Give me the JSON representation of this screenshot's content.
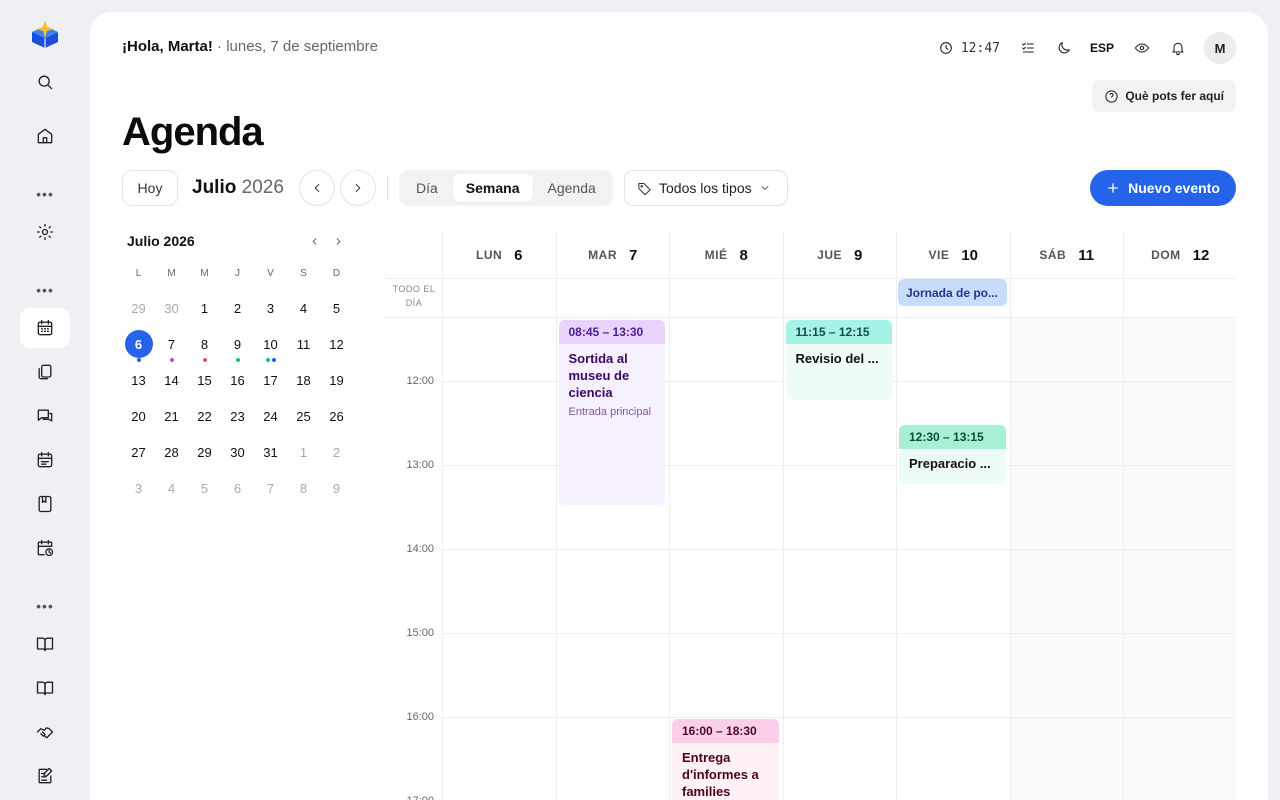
{
  "sidebar": {
    "items": [
      {
        "name": "search-icon"
      },
      {
        "name": "home-icon"
      },
      {
        "name": "settings-icon"
      },
      {
        "name": "calendar-icon"
      },
      {
        "name": "documents-icon"
      },
      {
        "name": "messages-icon"
      },
      {
        "name": "schedule-icon"
      },
      {
        "name": "notebook-icon"
      },
      {
        "name": "calendar-clock-icon"
      },
      {
        "name": "book-open-icon"
      },
      {
        "name": "book-icon"
      },
      {
        "name": "handshake-icon"
      },
      {
        "name": "edit-notes-icon"
      }
    ],
    "dots": "•••"
  },
  "header": {
    "greeting": "¡Hola, Marta!",
    "separator": " · ",
    "date": "lunes, 7 de septiembre",
    "clock": "12:47",
    "language": "ESP",
    "avatar_initial": "M",
    "help_label": "Què pots fer aquí"
  },
  "page": {
    "title": "Agenda"
  },
  "toolbar": {
    "today_label": "Hoy",
    "month": "Julio",
    "year": "2026",
    "views": [
      "Día",
      "Semana",
      "Agenda"
    ],
    "active_view": "Semana",
    "filter_label": "Todos los tipos",
    "new_event_label": "Nuevo evento"
  },
  "mini_calendar": {
    "title": "Julio 2026",
    "dow": [
      "L",
      "M",
      "M",
      "J",
      "V",
      "S",
      "D"
    ],
    "weeks": [
      [
        "29",
        "30",
        "1",
        "2",
        "3",
        "4",
        "5"
      ],
      [
        "6",
        "7",
        "8",
        "9",
        "10",
        "11",
        "12"
      ],
      [
        "13",
        "14",
        "15",
        "16",
        "17",
        "18",
        "19"
      ],
      [
        "20",
        "21",
        "22",
        "23",
        "24",
        "25",
        "26"
      ],
      [
        "27",
        "28",
        "29",
        "30",
        "31",
        "1",
        "2"
      ],
      [
        "3",
        "4",
        "5",
        "6",
        "7",
        "8",
        "9"
      ]
    ],
    "today": "6",
    "dots": {
      "6": [
        "#2563eb"
      ],
      "7": [
        "#a855f7"
      ],
      "8": [
        "#ec4899"
      ],
      "9": [
        "#14b8a6"
      ],
      "10": [
        "#14b8a6",
        "#2563eb"
      ]
    }
  },
  "week": {
    "days": [
      {
        "dow": "LUN",
        "num": "6"
      },
      {
        "dow": "MAR",
        "num": "7"
      },
      {
        "dow": "MIÉ",
        "num": "8"
      },
      {
        "dow": "JUE",
        "num": "9"
      },
      {
        "dow": "VIE",
        "num": "10"
      },
      {
        "dow": "SÁB",
        "num": "11"
      },
      {
        "dow": "DOM",
        "num": "12"
      }
    ],
    "allday_label": "TODO EL DÍA",
    "hours": [
      "12:00",
      "13:00",
      "14:00",
      "15:00",
      "16:00",
      "17:00"
    ],
    "allday_events": [
      {
        "day": 4,
        "title": "Jornada de po..."
      }
    ],
    "events": [
      {
        "day": 1,
        "time": "08:45 – 13:30",
        "title": "Sortida al museu de ciencia",
        "location": "Entrada principal",
        "color": "purple"
      },
      {
        "day": 3,
        "time": "11:15 – 12:15",
        "title": "Revisio del ...",
        "color": "teal"
      },
      {
        "day": 4,
        "time": "12:30 – 13:15",
        "title": "Preparacio ...",
        "color": "green"
      },
      {
        "day": 2,
        "time": "16:00 – 18:30",
        "title": "Entrega d'informes a families",
        "color": "pink"
      }
    ]
  },
  "colors": {
    "accent": "#2563eb",
    "purple_head": "#e7d3fb",
    "purple_body": "#f7f0fe",
    "teal_head": "#a5f3e4",
    "teal_body": "#effcf9",
    "green_head": "#a7f0d4",
    "green_body": "#eefcf6",
    "pink_head": "#fbcfe8",
    "pink_body": "#fdf0f7"
  }
}
